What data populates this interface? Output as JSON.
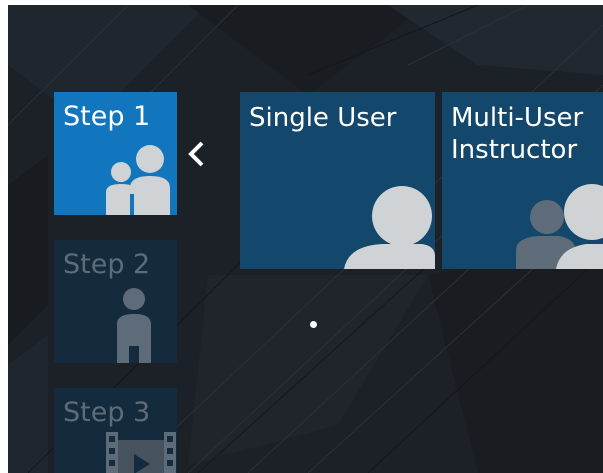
{
  "steps": [
    {
      "label": "Step 1",
      "state": "active",
      "icon": "user-pair-icon"
    },
    {
      "label": "Step 2",
      "state": "inactive",
      "icon": "single-user-icon"
    },
    {
      "label": "Step 3",
      "state": "inactive",
      "icon": "film-icon"
    }
  ],
  "modes": [
    {
      "label": "Single User",
      "icon": "single-user-icon"
    },
    {
      "label": "Multi-User\nInstructor",
      "icon": "multi-user-icon"
    }
  ],
  "nav": {
    "back_icon": "chevron-left-icon"
  },
  "colors": {
    "background": "#1c2127",
    "step_active": "#1176bd",
    "step_inactive": "#142b3d",
    "mode_tile": "#13476b",
    "icon_light": "#cfd3d6",
    "icon_dim": "#5d6c78"
  }
}
